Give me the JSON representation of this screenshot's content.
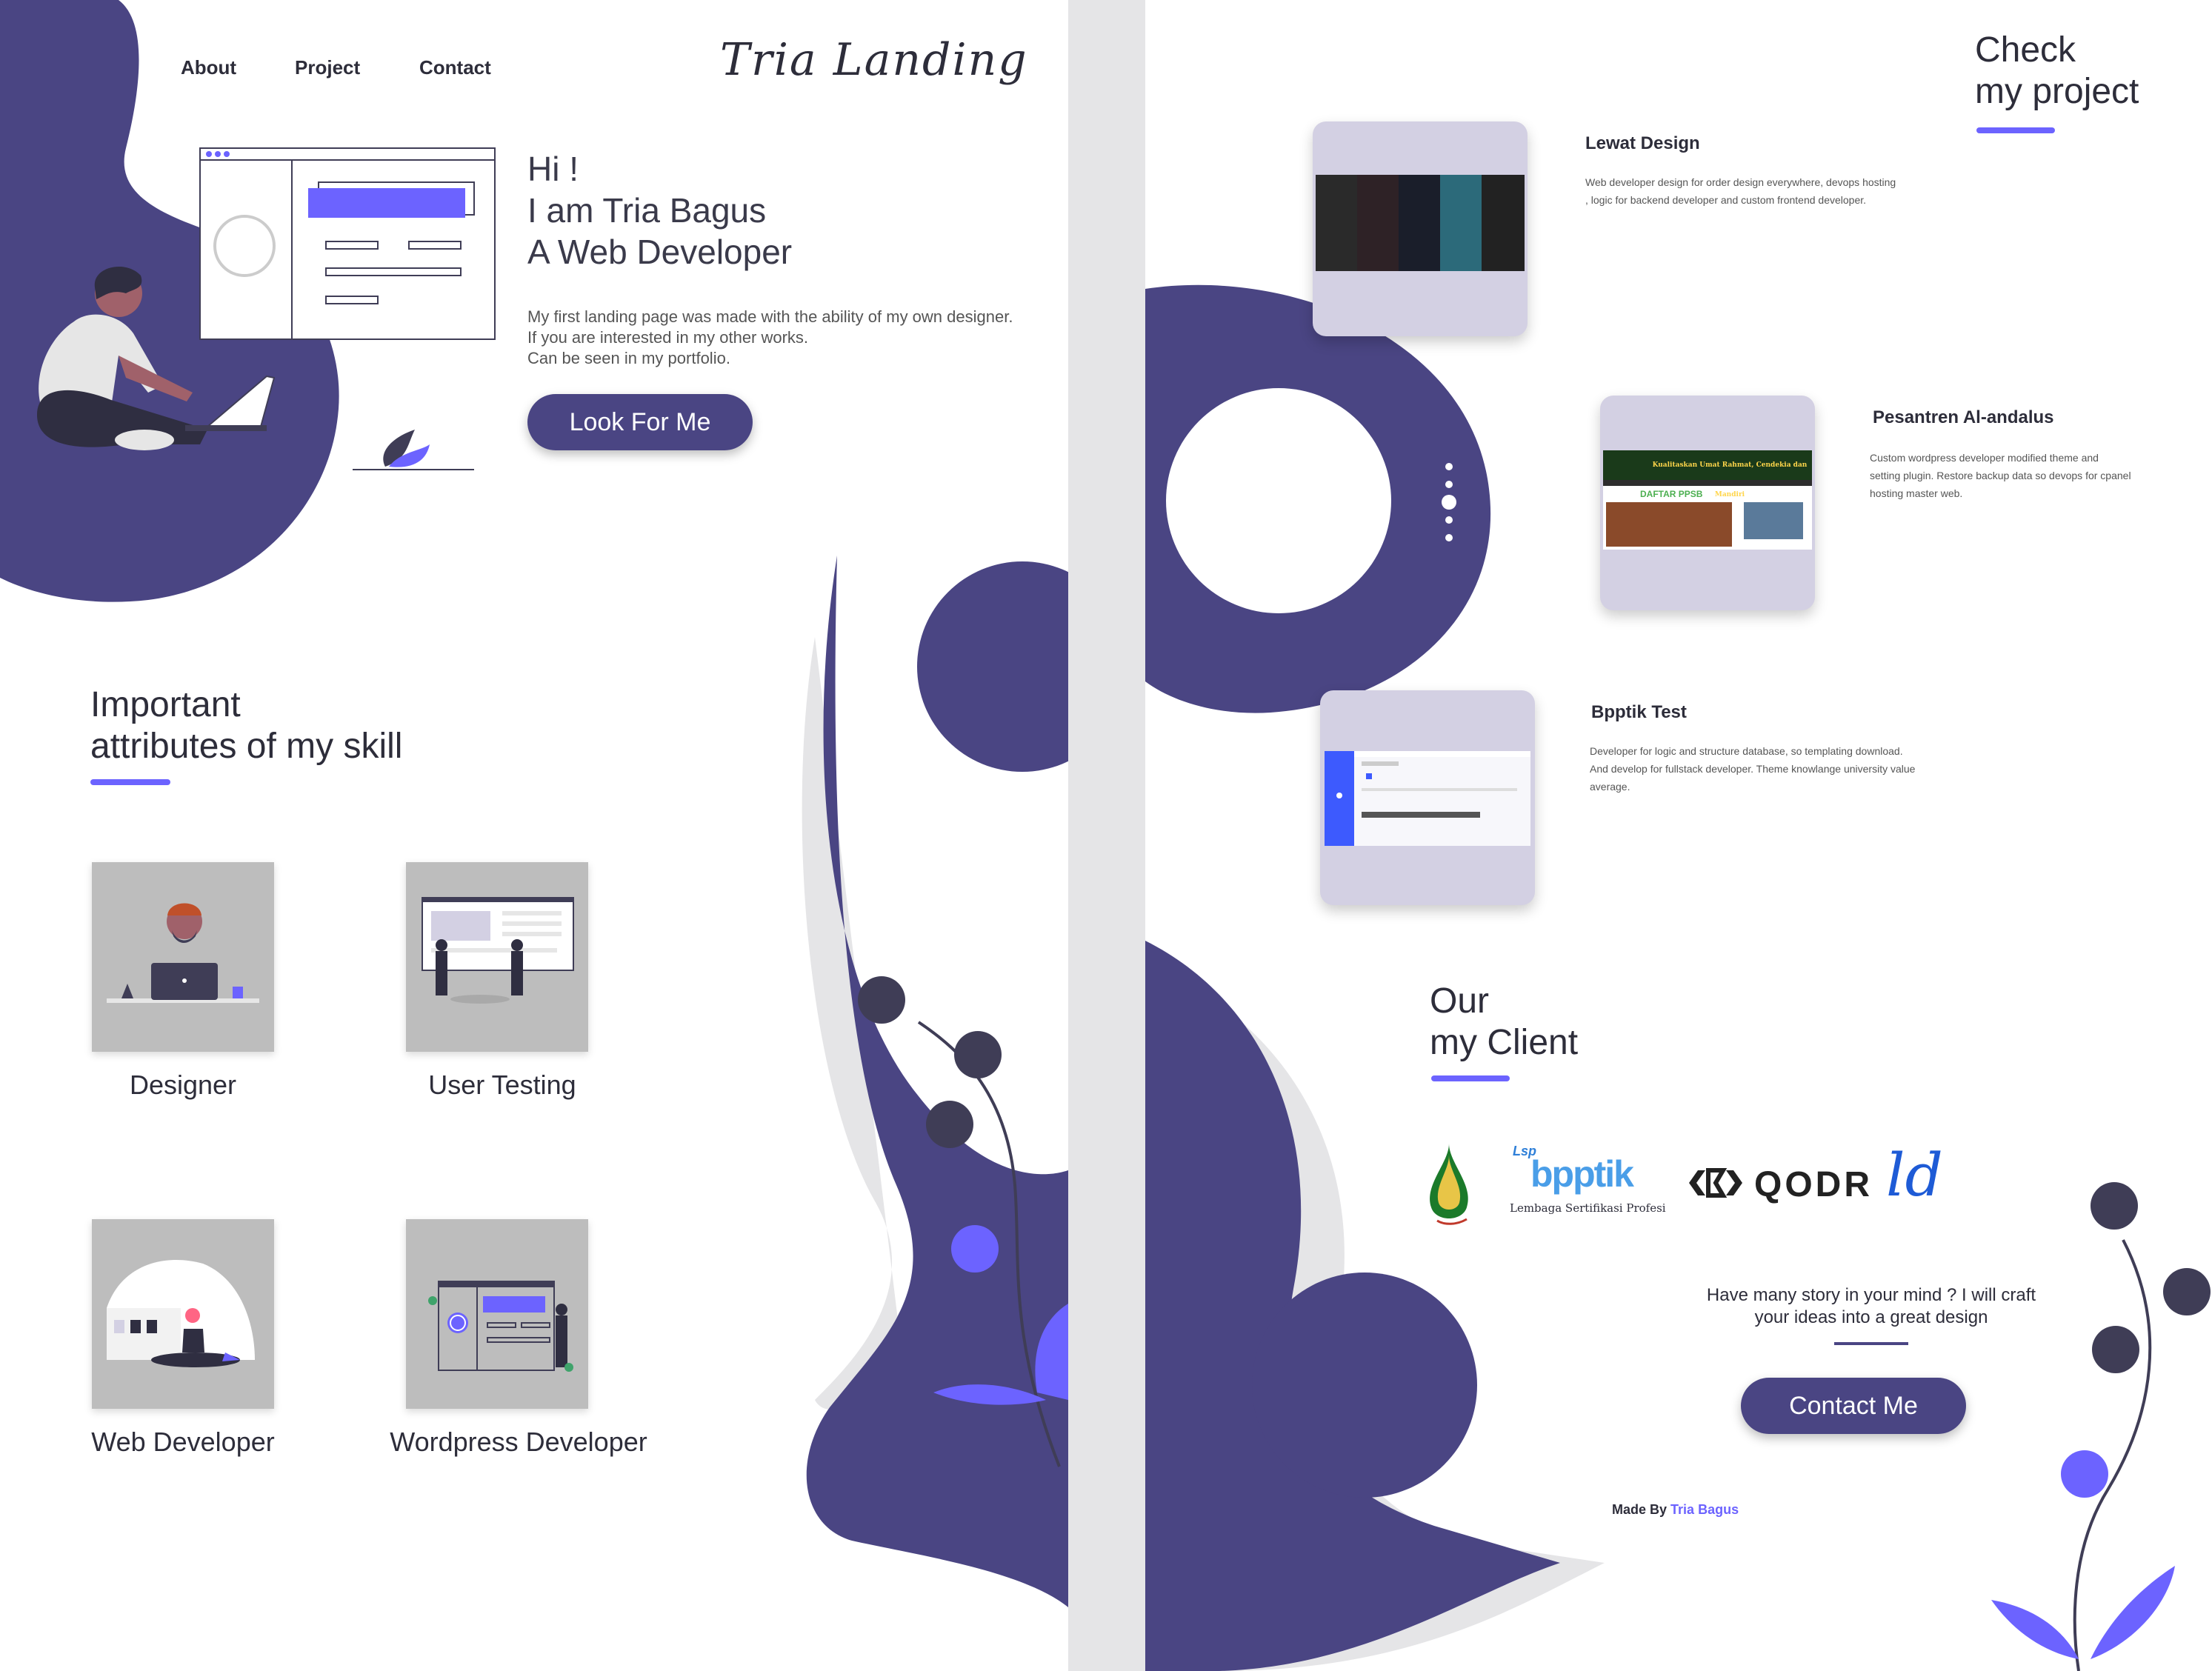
{
  "colors": {
    "primary": "#4a4583",
    "accent": "#6c63ff",
    "light_purple": "#d3d0e3",
    "gray": "#e5e5e7",
    "dark_dot": "#3f3d56"
  },
  "nav": {
    "about": "About",
    "project": "Project",
    "contact": "Contact"
  },
  "brand": "Tria Landing",
  "hero": {
    "greeting": "Hi !",
    "intro": "I am Tria Bagus",
    "role": "A Web Developer",
    "desc_line1": "My first landing page was made with the ability of my own designer.",
    "desc_line2": "If you are interested in my other works.",
    "desc_line3": "Can be seen in my portfolio.",
    "cta": "Look For Me"
  },
  "skills": {
    "title_line1": "Important",
    "title_line2": "attributes of my skill",
    "items": [
      {
        "label": "Designer",
        "icon": "designer-illustration"
      },
      {
        "label": "User Testing",
        "icon": "user-testing-illustration"
      },
      {
        "label": "Web Developer",
        "icon": "web-developer-illustration"
      },
      {
        "label": "Wordpress Developer",
        "icon": "wordpress-illustration"
      }
    ]
  },
  "projects": {
    "title_line1": "Check",
    "title_line2": "my project",
    "items": [
      {
        "title": "Lewat Design",
        "desc_line1": "Web developer design for order design everywhere, devops hosting",
        "desc_line2": ", logic for backend developer and custom frontend developer.",
        "desc_line3": ""
      },
      {
        "title": "Pesantren Al-andalus",
        "desc_line1": "Custom wordpress developer modified  theme and",
        "desc_line2": "setting plugin. Restore backup data so devops for cpanel",
        "desc_line3": "hosting master web."
      },
      {
        "title": "Bpptik Test",
        "desc_line1": "Developer for logic and structure database, so templating download.",
        "desc_line2": "And develop for fullstack developer. Theme knowlange university value",
        "desc_line3": "average."
      }
    ],
    "thumb2_banner": "Kualitaskan Umat Rahmat, Cendekia dan Mandiri",
    "thumb2_daftar": "DAFTAR PPSB"
  },
  "clients": {
    "title_line1": "Our",
    "title_line2": "my Client",
    "bpptik_lsp": "Lsp",
    "bpptik_name": "bpptik",
    "bpptik_sub": "Lembaga Sertifikasi Profesi",
    "qodr": "QODR",
    "ld": "ld"
  },
  "contact": {
    "line1": "Have many story in your mind ? I will craft",
    "line2": "your ideas into a great design",
    "cta": "Contact Me"
  },
  "footer": {
    "made_by": "Made By",
    "author": "Tria Bagus"
  }
}
